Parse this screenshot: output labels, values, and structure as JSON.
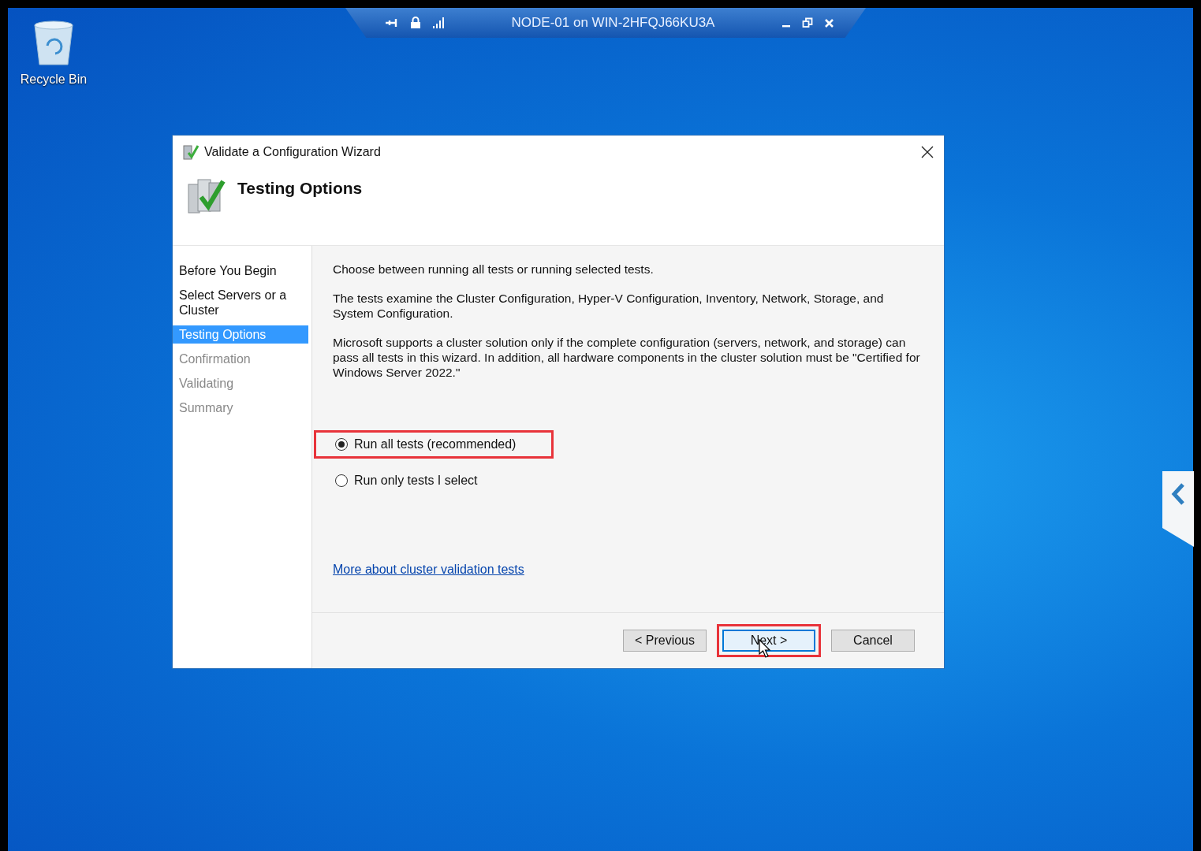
{
  "desktop": {
    "icons": [
      {
        "label": "Recycle Bin"
      }
    ]
  },
  "connection_bar": {
    "title": "NODE-01 on WIN-2HFQJ66KU3A"
  },
  "window": {
    "title": "Validate a Configuration Wizard",
    "heading": "Testing Options"
  },
  "steps": [
    {
      "label": "Before You Begin",
      "selected": false,
      "disabled": false
    },
    {
      "label": "Select Servers or a Cluster",
      "selected": false,
      "disabled": false
    },
    {
      "label": "Testing Options",
      "selected": true,
      "disabled": false
    },
    {
      "label": "Confirmation",
      "selected": false,
      "disabled": true
    },
    {
      "label": "Validating",
      "selected": false,
      "disabled": true
    },
    {
      "label": "Summary",
      "selected": false,
      "disabled": true
    }
  ],
  "paragraphs": [
    "Choose between running all tests or running selected tests.",
    "The tests examine the Cluster Configuration, Hyper-V Configuration, Inventory, Network, Storage, and System Configuration.",
    "Microsoft supports a cluster solution only if the complete configuration (servers, network, and storage) can pass all tests in this wizard. In addition, all hardware components in the cluster solution must be \"Certified for Windows Server 2022.\""
  ],
  "options": [
    {
      "label": "Run all tests (recommended)",
      "selected": true,
      "highlighted": true
    },
    {
      "label": "Run only tests I select",
      "selected": false,
      "highlighted": false
    }
  ],
  "link": "More about cluster validation tests",
  "buttons": [
    {
      "label": "< Previous",
      "default": false,
      "highlighted": false
    },
    {
      "label": "Next >",
      "default": true,
      "highlighted": true
    },
    {
      "label": "Cancel",
      "default": false,
      "highlighted": false
    }
  ]
}
